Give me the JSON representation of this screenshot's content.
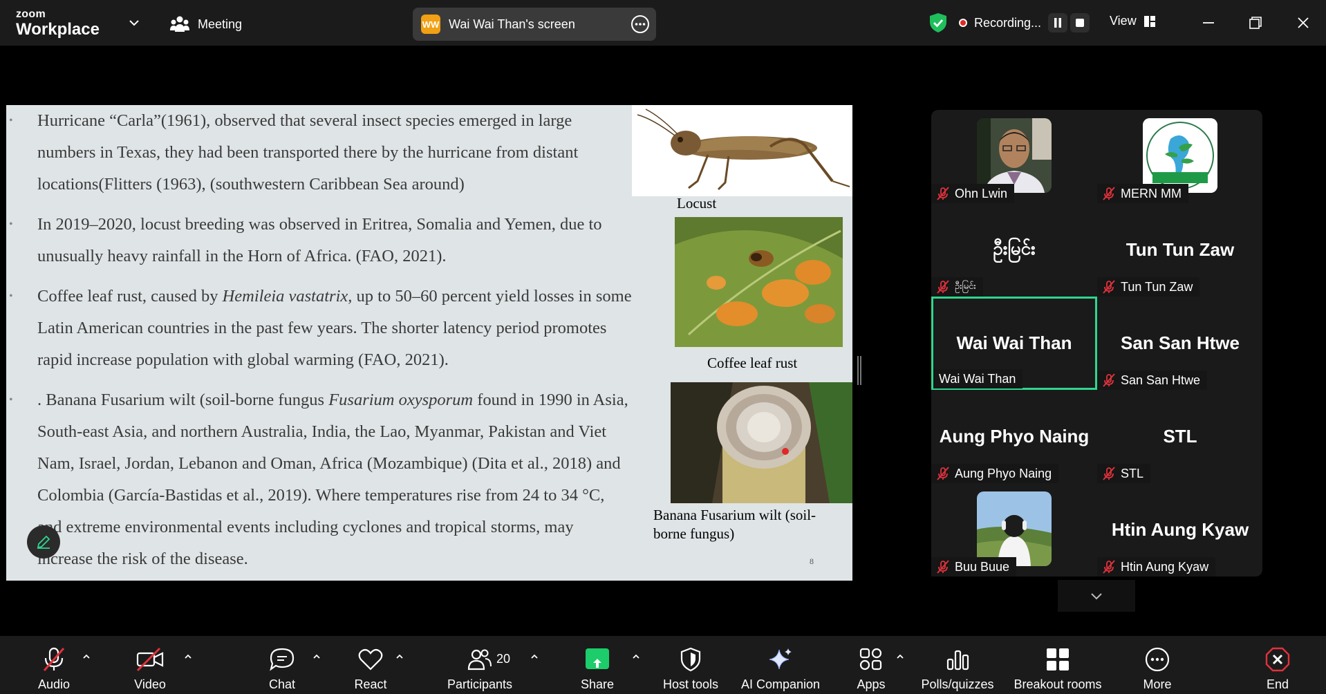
{
  "titlebar": {
    "logo_top": "zoom",
    "logo_bottom": "Workplace",
    "meeting_label": "Meeting",
    "screen_share_label": "Wai Wai Than's screen",
    "screen_owner_initials": "WW",
    "recording_label": "Recording...",
    "view_label": "View"
  },
  "slide": {
    "paragraphs": [
      {
        "parts": [
          "Hurricane “Carla”(1961), observed that several insect species emerged in large numbers in Texas, they had been transported there by the hurricane from distant locations(Flitters (1963), (southwestern Caribbean Sea around)"
        ]
      },
      {
        "parts": [
          " In 2019–2020, locust breeding was observed in Eritrea, Somalia and Yemen, due to unusually heavy rainfall in the Horn of Africa. (FAO, 2021)."
        ]
      },
      {
        "pre": "Coffee leaf rust, caused by ",
        "em": "Hemileia vastatrix,",
        "post": " up to 50–60 percent yield losses in some Latin American countries in the past few years. The shorter latency period promotes rapid increase population with global warming (FAO, 2021)."
      },
      {
        "pre": ". Banana Fusarium wilt (soil-borne fungus ",
        "em": "Fusarium oxysporum",
        "post": " found in 1990 in Asia, South-east Asia, and northern Australia, India, the Lao, Myanmar, Pakistan and Viet Nam, Israel, Jordan, Lebanon and Oman, Africa (Mozambique) (Dita et al., 2018) and Colombia (García-Bastidas et al., 2019). Where temperatures rise from 24 to 34 °C, and extreme environmental events including cyclones and tropical storms, may increase the risk of the disease."
      }
    ],
    "captions": {
      "locust": "Locust",
      "coffee": "Coffee leaf rust",
      "banana": "Banana Fusarium wilt (soil-borne fungus)"
    },
    "page_number": "8"
  },
  "participants": [
    {
      "big": "",
      "tag": "Ohn Lwin",
      "avatar": "photo-man",
      "muted": true
    },
    {
      "big": "",
      "tag": "MERN MM",
      "avatar": "logo-mern",
      "muted": true
    },
    {
      "big": "ဦးမြင်း",
      "tag": "ဦးမြင်း",
      "avatar": "",
      "muted": true
    },
    {
      "big": "Tun Tun Zaw",
      "tag": "Tun Tun Zaw",
      "avatar": "",
      "muted": true
    },
    {
      "big": "Wai Wai Than",
      "tag": "Wai Wai Than",
      "avatar": "",
      "muted": false,
      "active": true
    },
    {
      "big": "San San Htwe",
      "tag": "San San Htwe",
      "avatar": "",
      "muted": true
    },
    {
      "big": "Aung Phyo Naing",
      "tag": "Aung Phyo Naing",
      "avatar": "",
      "muted": true
    },
    {
      "big": "STL",
      "tag": "STL",
      "avatar": "",
      "muted": true
    },
    {
      "big": "",
      "tag": "Buu Buue",
      "avatar": "photo-woman",
      "muted": true
    },
    {
      "big": "Htin Aung Kyaw",
      "tag": "Htin Aung Kyaw",
      "avatar": "",
      "muted": true
    }
  ],
  "toolbar": {
    "audio": "Audio",
    "video": "Video",
    "chat": "Chat",
    "react": "React",
    "participants": "Participants",
    "participant_count": "20",
    "share": "Share",
    "host_tools": "Host tools",
    "ai_companion": "AI Companion",
    "apps": "Apps",
    "polls": "Polls/quizzes",
    "breakout": "Breakout rooms",
    "more": "More",
    "end": "End"
  },
  "colors": {
    "accent_green": "#2fd68e",
    "share_green": "#1dcc6a",
    "record_red": "#e02828",
    "end_red": "#e0323c"
  }
}
